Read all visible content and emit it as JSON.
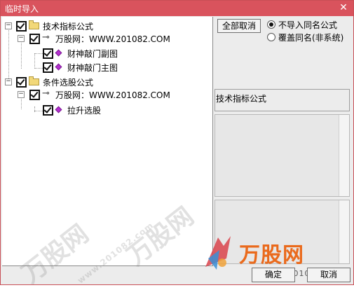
{
  "window": {
    "title": "临时导入",
    "close_label": "✕"
  },
  "tree": {
    "group1": {
      "label": "技术指标公式",
      "expander": "−"
    },
    "group1_source": {
      "label": "万股网：WWW.201082.COM",
      "expander": "−"
    },
    "group1_items": [
      "财神敲门副图",
      "财神敲门主图"
    ],
    "group2": {
      "label": "条件选股公式",
      "expander": "−"
    },
    "group2_source": {
      "label": "万股网：WWW.201082.COM",
      "expander": "−"
    },
    "group2_items": [
      "拉升选股"
    ]
  },
  "controls": {
    "select_all_button": "全部取消",
    "option_no_import": "不导入同名公式",
    "option_overwrite": "覆盖同名(非系统)",
    "selected_option": "option_no_import",
    "info_title": "技术指标公式"
  },
  "buttons": {
    "ok": "确定",
    "cancel": "取消"
  },
  "watermark": {
    "brand": "万股网",
    "site": "www.201082.com"
  },
  "icons": {
    "folder": "folder-icon",
    "key": "key-icon",
    "formula": "diamond-icon",
    "close": "close-icon"
  },
  "colors": {
    "titlebar": "#d9535d",
    "logo": "#ea6a1c",
    "formula_icon": "#b52fd1"
  }
}
